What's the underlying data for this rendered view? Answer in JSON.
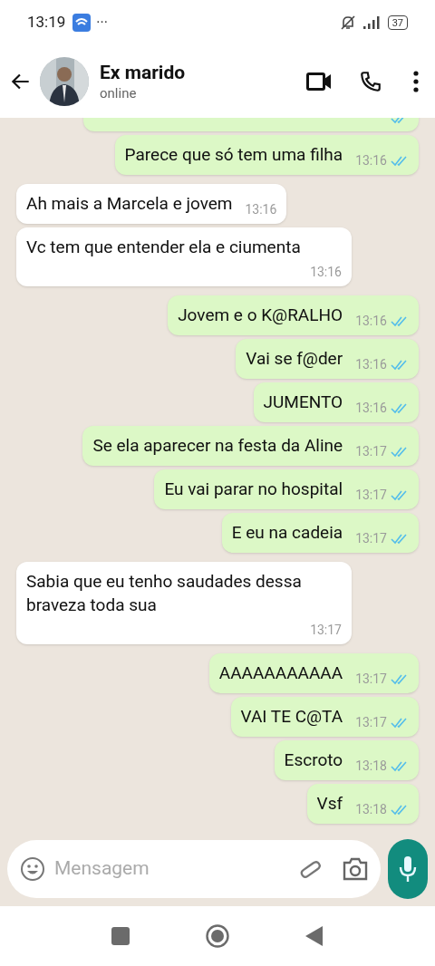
{
  "status_bar": {
    "time": "13:19",
    "more": "···",
    "battery": "37"
  },
  "header": {
    "name": "Ex marido",
    "status": "online"
  },
  "messages": [
    {
      "kind": "outgoing",
      "cut": true,
      "read": true
    },
    {
      "kind": "outgoing",
      "text": "Parece que só tem uma filha",
      "time": "13:16",
      "read": true
    },
    {
      "kind": "incoming",
      "text": "Ah mais a Marcela e jovem",
      "time": "13:16"
    },
    {
      "kind": "incoming",
      "text": "Vc tem que entender ela e ciumenta",
      "time": "13:16"
    },
    {
      "kind": "outgoing",
      "text": "Jovem e o K@RALHO",
      "time": "13:16",
      "read": true
    },
    {
      "kind": "outgoing",
      "text": "Vai se f@der",
      "time": "13:16",
      "read": true
    },
    {
      "kind": "outgoing",
      "text": "JUMENTO",
      "time": "13:16",
      "read": true
    },
    {
      "kind": "outgoing",
      "text": "Se ela aparecer na festa da Aline",
      "time": "13:17",
      "read": true
    },
    {
      "kind": "outgoing",
      "text": "Eu vai parar no hospital",
      "time": "13:17",
      "read": true
    },
    {
      "kind": "outgoing",
      "text": "E eu na cadeia",
      "time": "13:17",
      "read": true
    },
    {
      "kind": "incoming",
      "text": "Sabia que eu tenho saudades dessa braveza toda sua",
      "time": "13:17"
    },
    {
      "kind": "outgoing",
      "text": "AAAAAAAAAAA",
      "time": "13:17",
      "read": true
    },
    {
      "kind": "outgoing",
      "text": "VAI TE C@TA",
      "time": "13:17",
      "read": true
    },
    {
      "kind": "outgoing",
      "text": "Escroto",
      "time": "13:18",
      "read": true
    },
    {
      "kind": "outgoing",
      "text": "Vsf",
      "time": "13:18",
      "read": true
    }
  ],
  "composer": {
    "placeholder": "Mensagem"
  }
}
